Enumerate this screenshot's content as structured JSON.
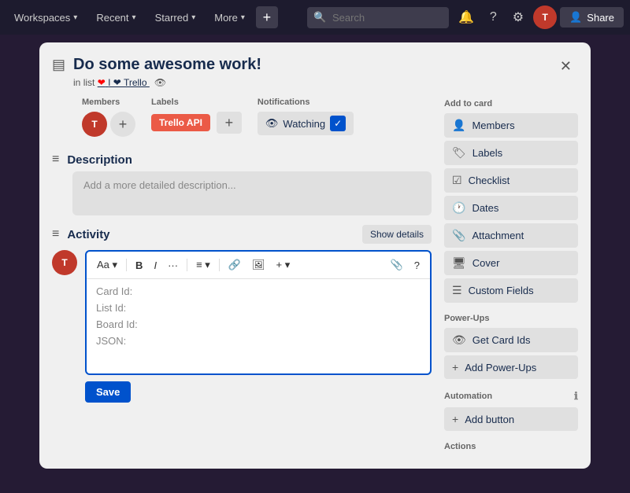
{
  "topnav": {
    "workspaces_label": "Workspaces",
    "recent_label": "Recent",
    "starred_label": "Starred",
    "more_label": "More",
    "search_placeholder": "Search",
    "share_label": "Share",
    "user_initials": "T"
  },
  "modal": {
    "card_icon": "▤",
    "title": "Do some awesome work!",
    "list_prefix": "in list",
    "list_name": "I ❤ Trello",
    "close_icon": "✕",
    "sections": {
      "members_label": "Members",
      "labels_label": "Labels",
      "notifications_label": "Notifications",
      "label_tag_text": "Trello API",
      "watching_text": "Watching",
      "description_title": "Description",
      "description_icon": "≡",
      "description_placeholder": "Add a more detailed description...",
      "activity_title": "Activity",
      "activity_icon": "≡",
      "show_details_label": "Show details"
    },
    "editor": {
      "card_id_label": "Card Id:",
      "list_id_label": "List Id:",
      "board_id_label": "Board Id:",
      "json_label": "JSON:"
    },
    "save_btn_label": "Save"
  },
  "sidebar": {
    "add_to_card_label": "Add to card",
    "members_btn": "Members",
    "labels_btn": "Labels",
    "checklist_btn": "Checklist",
    "dates_btn": "Dates",
    "attachment_btn": "Attachment",
    "cover_btn": "Cover",
    "custom_fields_btn": "Custom Fields",
    "power_ups_label": "Power-Ups",
    "get_card_ids_btn": "Get Card Ids",
    "add_power_ups_btn": "Add Power-Ups",
    "automation_label": "Automation",
    "add_button_btn": "Add button",
    "actions_label": "Actions",
    "icons": {
      "members": "👤",
      "labels": "🏷",
      "checklist": "☑",
      "dates": "🕐",
      "attachment": "📎",
      "cover": "🖼",
      "custom_fields": "☰",
      "eye": "👁",
      "plus": "+",
      "info": "ℹ"
    }
  }
}
